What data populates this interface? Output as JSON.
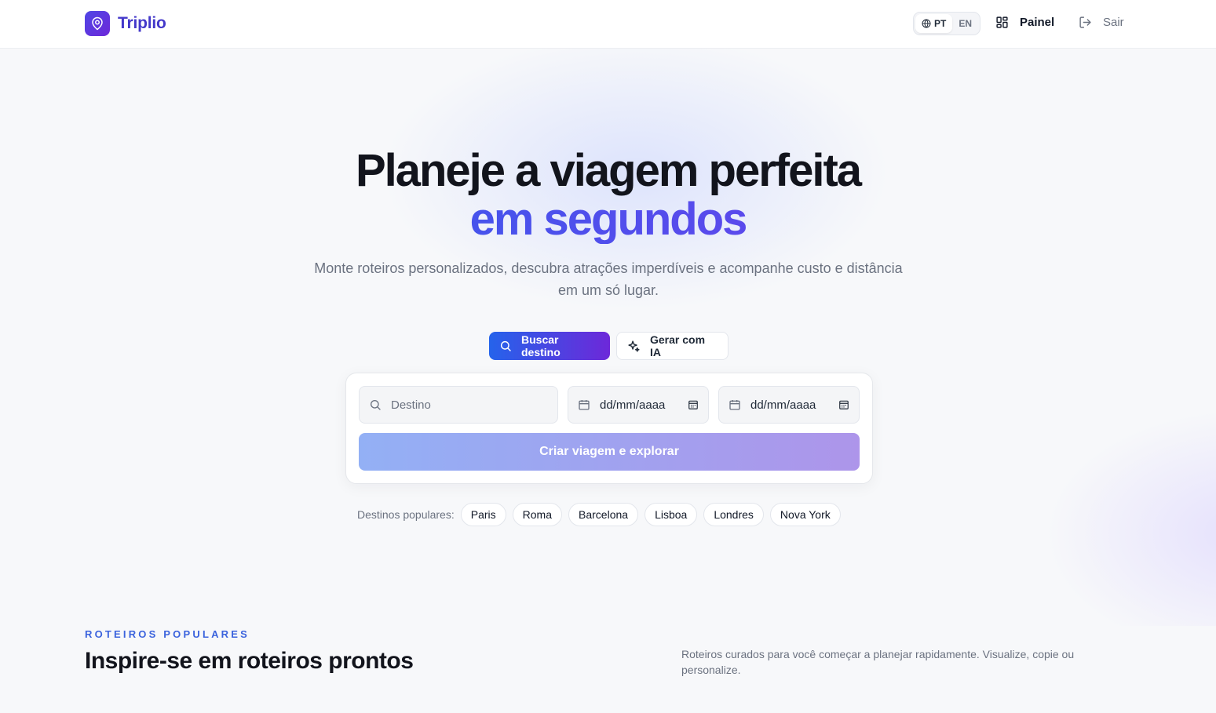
{
  "header": {
    "brand": "Triplio",
    "lang": {
      "active": "PT",
      "other": "EN"
    },
    "nav": {
      "panel": "Painel",
      "logout": "Sair"
    }
  },
  "hero": {
    "title_line1": "Planeje a viagem perfeita",
    "title_line2": "em segundos",
    "subtitle": "Monte roteiros personalizados, descubra atrações imperdíveis e acompanhe custo e distância em um só lugar."
  },
  "modes": {
    "search": "Buscar destino",
    "ai": "Gerar com IA"
  },
  "form": {
    "destination_placeholder": "Destino",
    "start_date": "dd/mm/aaaa",
    "end_date": "dd/mm/aaaa",
    "submit": "Criar viagem e explorar"
  },
  "popular": {
    "label": "Destinos populares:",
    "items": [
      "Paris",
      "Roma",
      "Barcelona",
      "Lisboa",
      "Londres",
      "Nova York"
    ]
  },
  "section": {
    "eyebrow": "ROTEIROS POPULARES",
    "title": "Inspire-se em roteiros prontos",
    "description": "Roteiros curados para você começar a planejar rapidamente. Visualize, copie ou personalize."
  },
  "colors": {
    "brand": "#4f46e5",
    "accent_start": "#2563eb",
    "accent_end": "#7c3aed"
  },
  "icons": {
    "logo": "map-pin-icon",
    "lang": "globe-icon",
    "panel": "grid-icon",
    "logout": "logout-icon",
    "search": "search-icon",
    "ai": "sparkles-icon",
    "calendar": "calendar-icon"
  }
}
